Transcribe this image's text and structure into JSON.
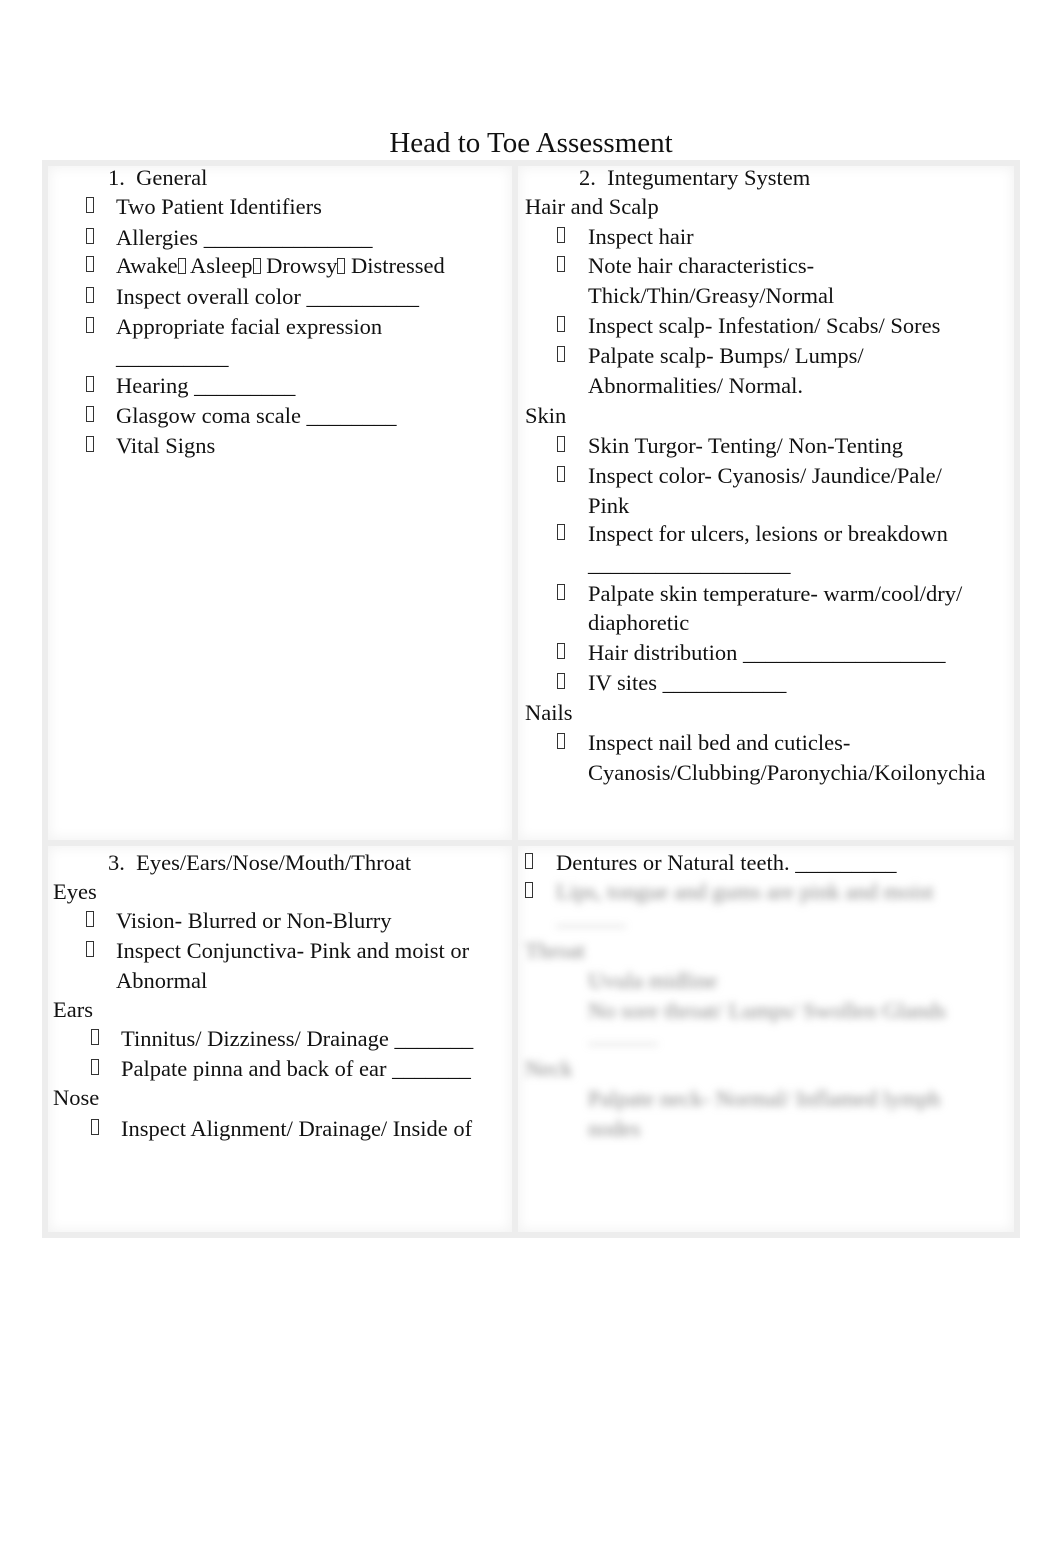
{
  "document": {
    "title": "Head to Toe Assessment"
  },
  "sections": {
    "general": {
      "heading_number": "1.",
      "heading": "General",
      "items": [
        "Two Patient Identifiers",
        "Allergies _______________",
        "Awake ",
        "Inspect overall color __________",
        "Appropriate facial expression",
        "__________",
        "Hearing _________",
        "Glasgow coma scale ________",
        "Vital Signs"
      ],
      "state_options": [
        "Awake",
        "Asleep",
        "Drowsy",
        "Distressed"
      ]
    },
    "integumentary": {
      "heading_number": "2.",
      "heading": "Integumentary System",
      "hair_scalp_label": "Hair and Scalp",
      "hair_scalp_items": [
        "Inspect hair",
        "Note hair characteristics-",
        "Thick/Thin/Greasy/Normal",
        "Inspect scalp- Infestation/ Scabs/ Sores",
        "Palpate scalp- Bumps/ Lumps/",
        "Abnormalities/ Normal."
      ],
      "skin_label": "Skin",
      "skin_items": [
        "Skin Turgor- Tenting/ Non-Tenting",
        "Inspect color- Cyanosis/ Jaundice/Pale/",
        "Pink",
        "Inspect for ulcers, lesions or breakdown",
        "__________________",
        "Palpate skin temperature- warm/cool/dry/",
        "diaphoretic",
        "Hair distribution __________________",
        "IV sites ___________"
      ],
      "nails_label": "Nails",
      "nails_items": [
        "Inspect nail bed and cuticles-",
        "Cyanosis/Clubbing/Paronychia/Koilonychia"
      ]
    },
    "eent": {
      "heading_number": "3.",
      "heading": "Eyes/Ears/Nose/Mouth/Throat",
      "eyes_label": "Eyes",
      "eyes_items": [
        "Vision- Blurred or Non-Blurry",
        "Inspect Conjunctiva- Pink and moist or",
        "Abnormal"
      ],
      "ears_label": "Ears",
      "ears_items": [
        "Tinnitus/ Dizziness/ Drainage _______",
        "Palpate pinna and back of ear _______"
      ],
      "nose_label": "Nose",
      "nose_items": [
        "Inspect Alignment/ Drainage/ Inside of"
      ]
    },
    "continued": {
      "items": [
        "Dentures or Natural teeth. _________"
      ],
      "blurred_placeholder": [
        "Lips, tongue and gums are pink and moist",
        "__________",
        "Throat",
        "Uvula midline",
        "No sore throat/ Lumps/ Swollen Glands",
        "__________",
        "Neck",
        "Palpate neck- Normal/ Inflamed lymph",
        "nodes"
      ]
    }
  }
}
